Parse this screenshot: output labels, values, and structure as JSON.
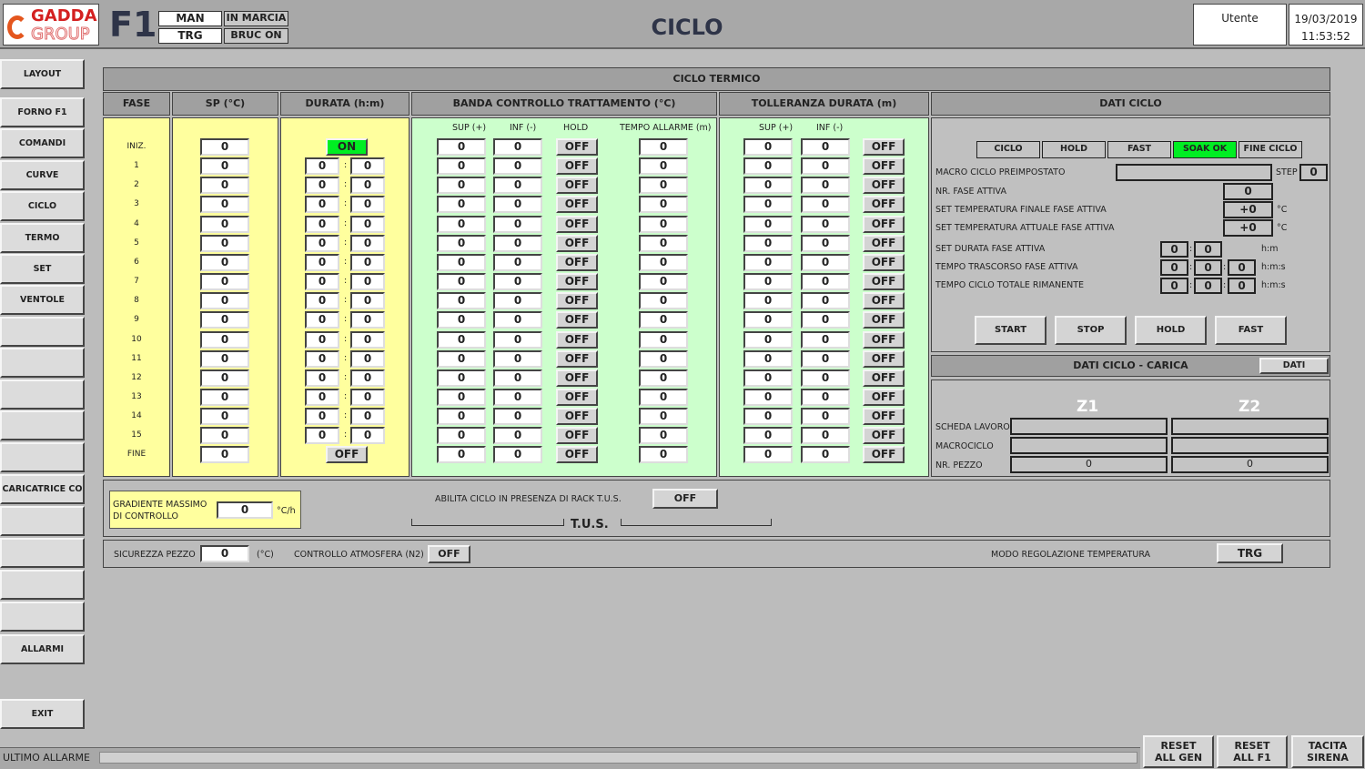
{
  "header": {
    "brand_line1": "GADDA",
    "brand_line2": "GROUP",
    "furnace": "F1",
    "mode": "MAN",
    "regulation": "TRG",
    "status": "IN MARCIA",
    "burner": "BRUC ON",
    "title": "CICLO",
    "user": "Utente",
    "date": "19/03/2019",
    "time": "11:53:52"
  },
  "sidebar": [
    "LAYOUT",
    "FORNO F1",
    "COMANDI",
    "CURVE",
    "CICLO",
    "TERMO",
    "SET",
    "VENTOLE",
    "",
    "",
    "",
    "",
    "",
    "CARICATRICE CO",
    "",
    "",
    "",
    "",
    "ALLARMI",
    "EXIT"
  ],
  "main": {
    "title": "CICLO TERMICO",
    "columns": {
      "fase": "FASE",
      "sp": "SP (°C)",
      "durata": "DURATA (h:m)",
      "banda": "BANDA CONTROLLO TRATTAMENTO (°C)",
      "tolleranza": "TOLLERANZA DURATA (m)",
      "dati": "DATI CICLO"
    },
    "banda_sub": {
      "sup": "SUP (+)",
      "inf": "INF (-)",
      "hold": "HOLD",
      "tempo": "TEMPO ALLARME (m)"
    },
    "toll_sub": {
      "sup": "SUP (+)",
      "inf": "INF (-)"
    },
    "rows": [
      {
        "fase": "INIZ.",
        "sp": "0",
        "durata": "ON",
        "sup": "0",
        "inf": "0",
        "hold": "OFF",
        "tempo": "0",
        "t_sup": "0",
        "t_inf": "0",
        "t_state": "OFF"
      },
      {
        "fase": "1",
        "sp": "0",
        "h": "0",
        "m": "0",
        "sup": "0",
        "inf": "0",
        "hold": "OFF",
        "tempo": "0",
        "t_sup": "0",
        "t_inf": "0",
        "t_state": "OFF"
      },
      {
        "fase": "2",
        "sp": "0",
        "h": "0",
        "m": "0",
        "sup": "0",
        "inf": "0",
        "hold": "OFF",
        "tempo": "0",
        "t_sup": "0",
        "t_inf": "0",
        "t_state": "OFF"
      },
      {
        "fase": "3",
        "sp": "0",
        "h": "0",
        "m": "0",
        "sup": "0",
        "inf": "0",
        "hold": "OFF",
        "tempo": "0",
        "t_sup": "0",
        "t_inf": "0",
        "t_state": "OFF"
      },
      {
        "fase": "4",
        "sp": "0",
        "h": "0",
        "m": "0",
        "sup": "0",
        "inf": "0",
        "hold": "OFF",
        "tempo": "0",
        "t_sup": "0",
        "t_inf": "0",
        "t_state": "OFF"
      },
      {
        "fase": "5",
        "sp": "0",
        "h": "0",
        "m": "0",
        "sup": "0",
        "inf": "0",
        "hold": "OFF",
        "tempo": "0",
        "t_sup": "0",
        "t_inf": "0",
        "t_state": "OFF"
      },
      {
        "fase": "6",
        "sp": "0",
        "h": "0",
        "m": "0",
        "sup": "0",
        "inf": "0",
        "hold": "OFF",
        "tempo": "0",
        "t_sup": "0",
        "t_inf": "0",
        "t_state": "OFF"
      },
      {
        "fase": "7",
        "sp": "0",
        "h": "0",
        "m": "0",
        "sup": "0",
        "inf": "0",
        "hold": "OFF",
        "tempo": "0",
        "t_sup": "0",
        "t_inf": "0",
        "t_state": "OFF"
      },
      {
        "fase": "8",
        "sp": "0",
        "h": "0",
        "m": "0",
        "sup": "0",
        "inf": "0",
        "hold": "OFF",
        "tempo": "0",
        "t_sup": "0",
        "t_inf": "0",
        "t_state": "OFF"
      },
      {
        "fase": "9",
        "sp": "0",
        "h": "0",
        "m": "0",
        "sup": "0",
        "inf": "0",
        "hold": "OFF",
        "tempo": "0",
        "t_sup": "0",
        "t_inf": "0",
        "t_state": "OFF"
      },
      {
        "fase": "10",
        "sp": "0",
        "h": "0",
        "m": "0",
        "sup": "0",
        "inf": "0",
        "hold": "OFF",
        "tempo": "0",
        "t_sup": "0",
        "t_inf": "0",
        "t_state": "OFF"
      },
      {
        "fase": "11",
        "sp": "0",
        "h": "0",
        "m": "0",
        "sup": "0",
        "inf": "0",
        "hold": "OFF",
        "tempo": "0",
        "t_sup": "0",
        "t_inf": "0",
        "t_state": "OFF"
      },
      {
        "fase": "12",
        "sp": "0",
        "h": "0",
        "m": "0",
        "sup": "0",
        "inf": "0",
        "hold": "OFF",
        "tempo": "0",
        "t_sup": "0",
        "t_inf": "0",
        "t_state": "OFF"
      },
      {
        "fase": "13",
        "sp": "0",
        "h": "0",
        "m": "0",
        "sup": "0",
        "inf": "0",
        "hold": "OFF",
        "tempo": "0",
        "t_sup": "0",
        "t_inf": "0",
        "t_state": "OFF"
      },
      {
        "fase": "14",
        "sp": "0",
        "h": "0",
        "m": "0",
        "sup": "0",
        "inf": "0",
        "hold": "OFF",
        "tempo": "0",
        "t_sup": "0",
        "t_inf": "0",
        "t_state": "OFF"
      },
      {
        "fase": "15",
        "sp": "0",
        "h": "0",
        "m": "0",
        "sup": "0",
        "inf": "0",
        "hold": "OFF",
        "tempo": "0",
        "t_sup": "0",
        "t_inf": "0",
        "t_state": "OFF"
      },
      {
        "fase": "FINE",
        "sp": "0",
        "durata": "OFF",
        "sup": "0",
        "inf": "0",
        "hold": "OFF",
        "tempo": "0",
        "t_sup": "0",
        "t_inf": "0",
        "t_state": "OFF"
      }
    ]
  },
  "dati_ciclo": {
    "status_buttons": [
      {
        "label": "CICLO",
        "active": false
      },
      {
        "label": "HOLD",
        "active": false
      },
      {
        "label": "FAST",
        "active": false
      },
      {
        "label": "SOAK OK",
        "active": true
      },
      {
        "label": "FINE CICLO",
        "active": false
      }
    ],
    "macro_label": "MACRO CICLO PREIMPOSTATO",
    "macro_value": "",
    "step_label": "STEP",
    "step_value": "0",
    "fase_label": "NR. FASE ATTIVA",
    "fase_value": "0",
    "tfin_label": "SET TEMPERATURA FINALE FASE ATTIVA",
    "tfin_value": "+0",
    "tatt_label": "SET TEMPERATURA ATTUALE FASE ATTIVA",
    "tatt_value": "+0",
    "unit_c": "°C",
    "dur_label": "SET DURATA FASE ATTIVA",
    "dur_h": "0",
    "dur_m": "0",
    "unit_hm": "h:m",
    "tras_label": "TEMPO TRASCORSO FASE ATTIVA",
    "tras_h": "0",
    "tras_m": "0",
    "tras_s": "0",
    "rim_label": "TEMPO CICLO TOTALE RIMANENTE",
    "rim_h": "0",
    "rim_m": "0",
    "rim_s": "0",
    "unit_hms": "h:m:s",
    "actions": [
      "START",
      "STOP",
      "HOLD",
      "FAST"
    ]
  },
  "carica": {
    "title": "DATI CICLO - CARICA",
    "dati_button": "DATI",
    "z1": "Z1",
    "z2": "Z2",
    "scheda_label": "SCHEDA LAVORO",
    "macro_label": "MACROCICLO",
    "pezzo_label": "NR. PEZZO",
    "z1_scheda": "",
    "z2_scheda": "",
    "z1_macro": "",
    "z2_macro": "",
    "z1_pezzo": "0",
    "z2_pezzo": "0"
  },
  "tus": {
    "grad_label1": "GRADIENTE  MASSIMO",
    "grad_label2": "DI CONTROLLO",
    "grad_value": "0",
    "grad_unit": "°C/h",
    "abilita_label": "ABILITA CICLO IN PRESENZA DI RACK T.U.S.",
    "abilita_value": "OFF",
    "title": "T.U.S."
  },
  "bottom": {
    "sicurezza_label": "SICUREZZA PEZZO",
    "sicurezza_value": "0",
    "sicurezza_unit": "(°C)",
    "atmo_label": "CONTROLLO ATMOSFERA (N2)",
    "atmo_value": "OFF",
    "modo_label": "MODO REGOLAZIONE TEMPERATURA",
    "modo_value": "TRG"
  },
  "footer": {
    "alarm_label": "ULTIMO ALLARME",
    "alarm_text": "",
    "reset_gen": "RESET ALL GEN",
    "reset_f1": "RESET ALL F1",
    "tacita": "TACITA SIRENA"
  },
  "colors": {
    "active_green": "#00ee22",
    "yellow_panel": "#ffff9e",
    "green_panel": "#ccffcc",
    "brand_red": "#d42020"
  }
}
